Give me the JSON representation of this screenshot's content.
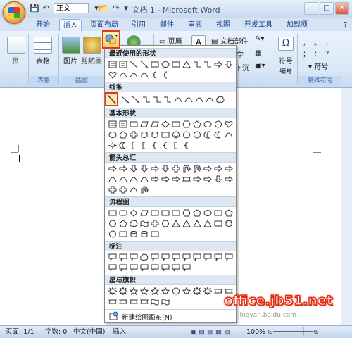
{
  "titlebar": {
    "style_box": "正文",
    "app_title": "文档 1 - Microsoft Word",
    "win": [
      "–",
      "□",
      "✕"
    ]
  },
  "tabs": [
    "开始",
    "插入",
    "页面布局",
    "引用",
    "邮件",
    "审阅",
    "视图",
    "开发工具",
    "加载项"
  ],
  "ribbon": {
    "page_label": "页",
    "table_label": "表格",
    "picture_label": "图片",
    "clip_label": "剪贴画",
    "group_tables": "表格",
    "group_illustrations": "插图",
    "header_label": "页眉",
    "docparts_label": "文档部件",
    "word_label": "字",
    "pattern_label": "下沉",
    "symbol_label": "符号",
    "number_label": "编号",
    "group_special": "特殊符号",
    "special_symbols": [
      "，",
      "。",
      "、",
      "；",
      "：",
      "？"
    ],
    "symbol_small": "符号"
  },
  "shape_menu": {
    "sections": [
      "最近使用的形状",
      "线条",
      "基本形状",
      "箭头总汇",
      "流程图",
      "标注",
      "星与旗帜"
    ],
    "footer": "新建绘图画布(N)"
  },
  "statusbar": {
    "page": "页面: 1/1",
    "words": "字数: 0",
    "lang": "中文(中国)",
    "mode": "插入",
    "zoom": "100%"
  },
  "watermark": "office.jb51.net",
  "watermark_small": "jingyan.baidu.com",
  "colors": {
    "highlight": "#e23a18",
    "ribbon": "#d9e7f7"
  }
}
